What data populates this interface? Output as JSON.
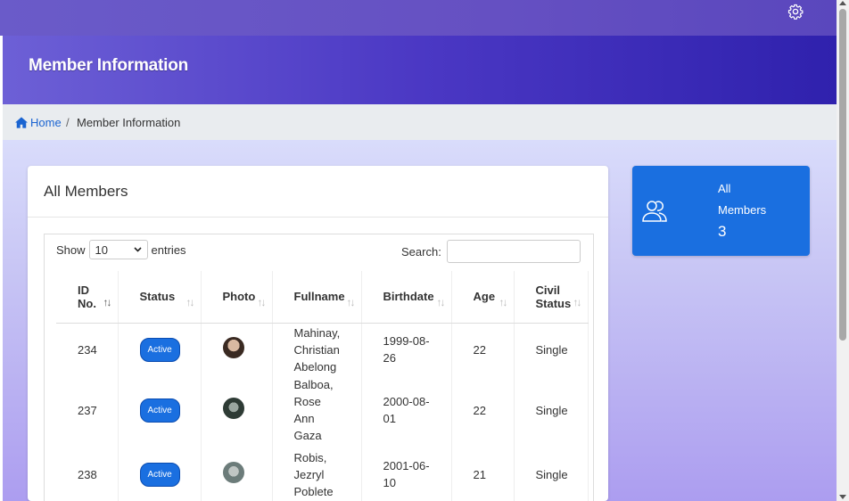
{
  "page": {
    "title": "Member Information"
  },
  "breadcrumb": {
    "home": "Home",
    "separator": "/",
    "current": "Member Information"
  },
  "card": {
    "title": "All Members"
  },
  "table_controls": {
    "show_label": "Show",
    "entries_value": "10",
    "entries_label": "entries",
    "search_label": "Search:",
    "search_value": ""
  },
  "columns": [
    {
      "line1": "ID",
      "line2": "No."
    },
    {
      "line1": "Status",
      "line2": ""
    },
    {
      "line1": "Photo",
      "line2": ""
    },
    {
      "line1": "Fullname",
      "line2": ""
    },
    {
      "line1": "Birthdate",
      "line2": ""
    },
    {
      "line1": "Age",
      "line2": ""
    },
    {
      "line1": "Civil",
      "line2": "Status"
    }
  ],
  "rows": [
    {
      "id": "234",
      "status": "Active",
      "name": [
        "Mahinay,",
        "Christian",
        "Abelong"
      ],
      "birthdate": [
        "1999-08-",
        "26"
      ],
      "age": "22",
      "civil": "Single"
    },
    {
      "id": "237",
      "status": "Active",
      "name": [
        "Balboa,",
        "Rose",
        "Ann",
        "Gaza"
      ],
      "birthdate": [
        "2000-08-",
        "01"
      ],
      "age": "22",
      "civil": "Single"
    },
    {
      "id": "238",
      "status": "Active",
      "name": [
        "Robis,",
        "Jezryl",
        "Poblete"
      ],
      "birthdate": [
        "2001-06-",
        "10"
      ],
      "age": "21",
      "civil": "Single"
    }
  ],
  "stat": {
    "label_line1": "All",
    "label_line2": "Members",
    "value": "3"
  },
  "colors": {
    "accent": "#1a6fe0",
    "header": "#4b38c4"
  },
  "icons": {
    "settings": "gear-icon",
    "home": "home-icon",
    "members": "users-icon"
  }
}
